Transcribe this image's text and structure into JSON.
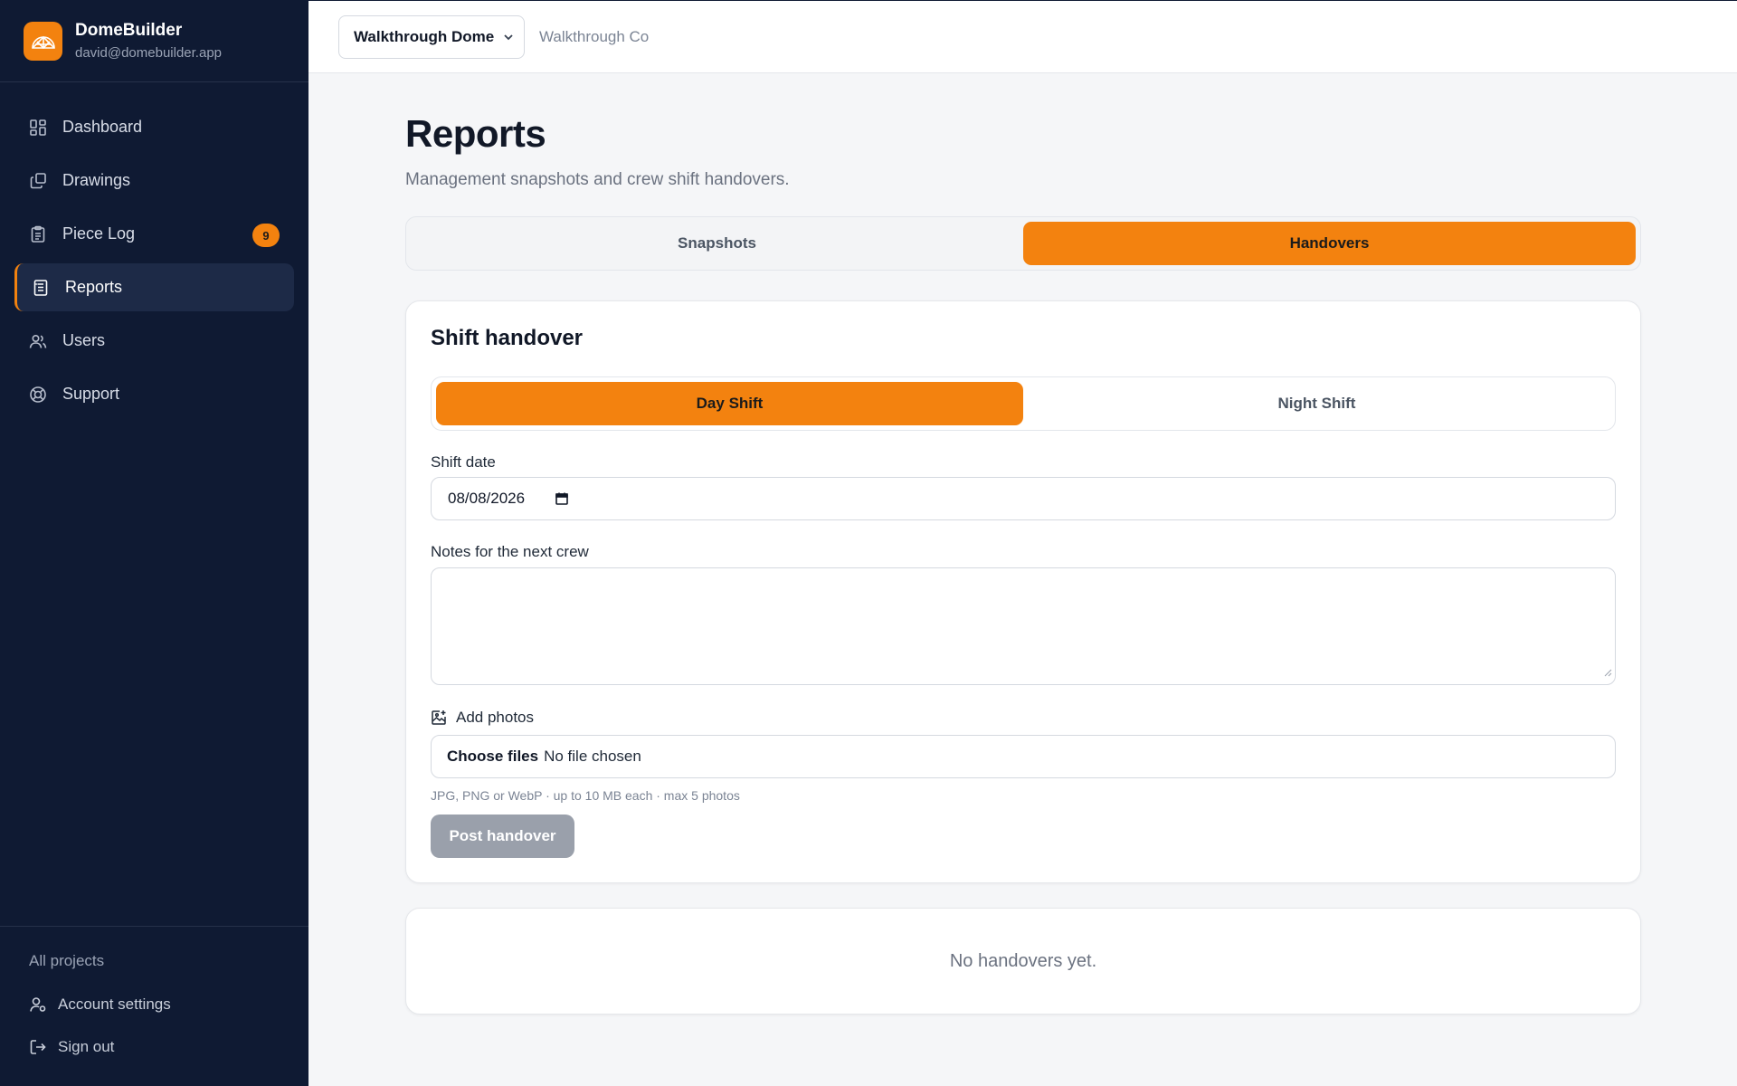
{
  "brand": {
    "name": "DomeBuilder",
    "email": "david@domebuilder.app",
    "logo_icon": "dome-icon",
    "accent": "#f3820f"
  },
  "sidebar": {
    "items": [
      {
        "label": "Dashboard",
        "icon": "grid-icon"
      },
      {
        "label": "Drawings",
        "icon": "layers-icon"
      },
      {
        "label": "Piece Log",
        "icon": "clipboard-icon",
        "badge": "9"
      },
      {
        "label": "Reports",
        "icon": "report-icon",
        "active": true
      },
      {
        "label": "Users",
        "icon": "users-icon"
      },
      {
        "label": "Support",
        "icon": "lifebuoy-icon"
      }
    ],
    "all_projects": "All projects",
    "account_settings": "Account settings",
    "sign_out": "Sign out"
  },
  "topbar": {
    "project": "Walkthrough Dome",
    "company": "Walkthrough Co"
  },
  "page": {
    "title": "Reports",
    "subtitle": "Management snapshots and crew shift handovers."
  },
  "tabs": [
    {
      "label": "Snapshots"
    },
    {
      "label": "Handovers",
      "active": true
    }
  ],
  "handover": {
    "title": "Shift handover",
    "shifts": [
      {
        "label": "Day Shift",
        "active": true
      },
      {
        "label": "Night Shift"
      }
    ],
    "date_label": "Shift date",
    "date_value": "08/08/2026",
    "notes_label": "Notes for the next crew",
    "notes_value": "",
    "photos_label": "Add photos",
    "file_button": "Choose files",
    "file_status": "No file chosen",
    "hint": "JPG, PNG or WebP · up to 10 MB each · max 5 photos",
    "submit": "Post handover"
  },
  "empty_state": "No handovers yet."
}
